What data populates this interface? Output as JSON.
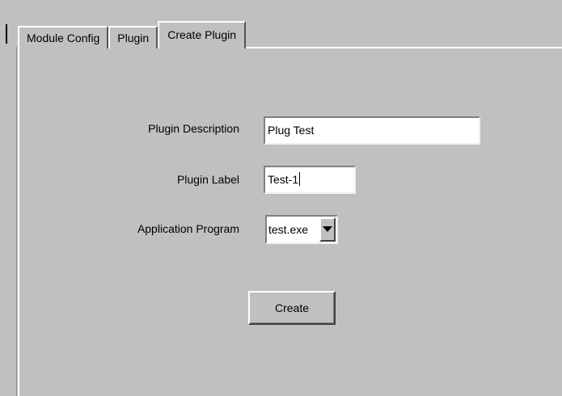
{
  "tabs": [
    {
      "label": "Module Config"
    },
    {
      "label": "Plugin"
    },
    {
      "label": "Create Plugin"
    }
  ],
  "active_tab": "Create Plugin",
  "form": {
    "description_label": "Plugin Description",
    "description_value": "Plug Test",
    "label_label": "Plugin Label",
    "label_value": "Test-1",
    "program_label": "Application Program",
    "program_value": "test.exe",
    "create_button": "Create"
  },
  "colors": {
    "background": "#c0c0c0",
    "input_background": "#ffffff"
  }
}
